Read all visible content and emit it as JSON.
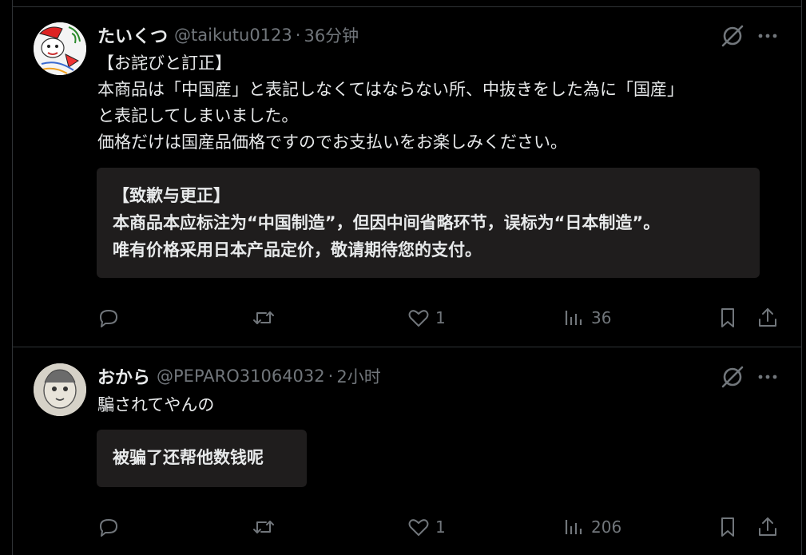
{
  "posts": [
    {
      "display_name": "たいくつ",
      "handle": "@taikutu0123",
      "separator": "·",
      "time": "36分钟",
      "text_lines": [
        "【お詫びと訂正】",
        "本商品は「中国産」と表記しなくてはならない所、中抜きをした為に「国産」",
        "と表記してしまいました。",
        "価格だけは国産品価格ですのでお支払いをお楽しみください。"
      ],
      "translation_lines": [
        "【致歉与更正】",
        "本商品本应标注为“中国制造”，但因中间省略环节，误标为“日本制造”。",
        "唯有价格采用日本产品定价，敬请期待您的支付。"
      ],
      "actions": {
        "reply": "",
        "retweet": "",
        "like": "1",
        "views": "36"
      }
    },
    {
      "display_name": "おから",
      "handle": "@PEPARO31064032",
      "separator": "·",
      "time": "2小时",
      "text_lines": [
        "騙されてやんの"
      ],
      "translation_lines": [
        "被骗了还帮他数钱呢"
      ],
      "actions": {
        "reply": "",
        "retweet": "",
        "like": "1",
        "views": "206"
      }
    }
  ],
  "colors": {
    "background": "#000000",
    "text": "#e7e9ea",
    "secondary_text": "#71767b",
    "translation_box": "#1f1d1d",
    "border": "#2f3336"
  }
}
